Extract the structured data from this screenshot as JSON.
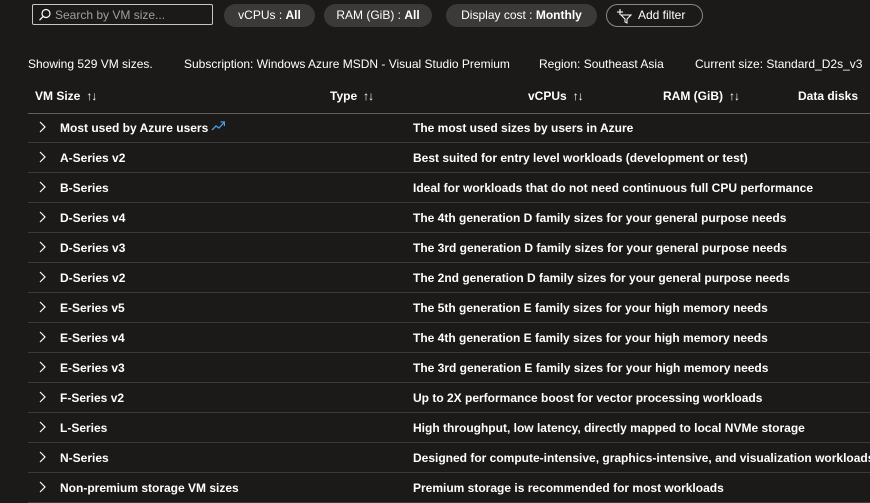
{
  "search": {
    "placeholder": "Search by VM size..."
  },
  "filters": {
    "vcpus": {
      "label": "vCPUs : ",
      "value": "All"
    },
    "ram": {
      "label": "RAM (GiB) : ",
      "value": "All"
    },
    "cost": {
      "label": "Display cost : ",
      "value": "Monthly"
    },
    "add_filter": "Add filter"
  },
  "info": {
    "showing": "Showing 529 VM sizes.",
    "subscription": "Subscription: Windows Azure MSDN - Visual Studio Premium",
    "region": "Region: Southeast Asia",
    "current_size": "Current size: Standard_D2s_v3"
  },
  "columns": {
    "vm_size": "VM Size",
    "type": "Type",
    "vcpus": "vCPUs",
    "ram": "RAM (GiB)",
    "data_disks": "Data disks",
    "sort_glyph": "↑↓"
  },
  "rows": [
    {
      "name": "Most used by Azure users",
      "desc": "The most used sizes by users in Azure"
    },
    {
      "name": "A-Series v2",
      "desc": "Best suited for entry level workloads (development or test)"
    },
    {
      "name": "B-Series",
      "desc": "Ideal for workloads that do not need continuous full CPU performance"
    },
    {
      "name": "D-Series v4",
      "desc": "The 4th generation D family sizes for your general purpose needs"
    },
    {
      "name": "D-Series v3",
      "desc": "The 3rd generation D family sizes for your general purpose needs"
    },
    {
      "name": "D-Series v2",
      "desc": "The 2nd generation D family sizes for your general purpose needs"
    },
    {
      "name": "E-Series v5",
      "desc": "The 5th generation E family sizes for your high memory needs"
    },
    {
      "name": "E-Series v4",
      "desc": "The 4th generation E family sizes for your high memory needs"
    },
    {
      "name": "E-Series v3",
      "desc": "The 3rd generation E family sizes for your high memory needs"
    },
    {
      "name": "F-Series v2",
      "desc": "Up to 2X performance boost for vector processing workloads"
    },
    {
      "name": "L-Series",
      "desc": "High throughput, low latency, directly mapped to local NVMe storage"
    },
    {
      "name": "N-Series",
      "desc": "Designed for compute-intensive, graphics-intensive, and visualization workloads"
    },
    {
      "name": "Non-premium storage VM sizes",
      "desc": "Premium storage is recommended for most workloads"
    }
  ],
  "icons": {
    "search": "search-icon",
    "chevron": "chevron-right-icon",
    "trend": "trending-icon",
    "add": "add-filter-icon"
  },
  "colors": {
    "background": "#1b1a19",
    "pill": "#3b3a39",
    "accent": "#4f9de8"
  }
}
